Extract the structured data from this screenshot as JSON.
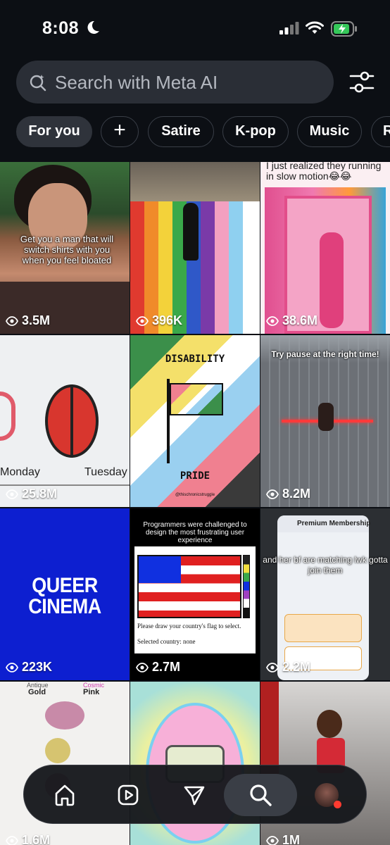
{
  "status": {
    "time": "8:08"
  },
  "search": {
    "placeholder": "Search with Meta AI"
  },
  "chips": [
    {
      "label": "For you"
    },
    {
      "label": "+"
    },
    {
      "label": "Satire"
    },
    {
      "label": "K-pop"
    },
    {
      "label": "Music"
    },
    {
      "label": "R"
    }
  ],
  "tiles": [
    {
      "views": "3.5M",
      "caption": "Get you a man that will switch shirts with you when you feel bloated"
    },
    {
      "views": "396K"
    },
    {
      "views": "38.6M",
      "caption": "I just realized they running in slow motion😂😂"
    },
    {
      "views": "25.8M",
      "text_left": "Monday",
      "text_right": "Tuesday"
    },
    {
      "views": "",
      "title": "DISABILITY",
      "subtitle": "PRIDE",
      "credit": "@thischronicstruggle"
    },
    {
      "views": "8.2M",
      "caption": "Try pause at the right time!"
    },
    {
      "views": "223K",
      "title_line1": "QUEER",
      "title_line2": "CINEMA"
    },
    {
      "views": "2.7M",
      "caption": "Programmers were challenged to design the most frustrating user experience",
      "prompt": "Please draw your country's flag to select.",
      "selected": "Selected country: none"
    },
    {
      "views": "2.2M",
      "caption": "and her bf are matching lwk gotta join them",
      "modal_title": "Premium Membership"
    },
    {
      "views": "1.6M",
      "label_left_top": "Antique",
      "label_left": "Gold",
      "label_right_top": "Cosmic",
      "label_right": "Pink"
    },
    {
      "views": ""
    },
    {
      "views": "1M"
    }
  ],
  "colors": {
    "accent_green": "#35c759",
    "notification_red": "#ff3b30"
  }
}
